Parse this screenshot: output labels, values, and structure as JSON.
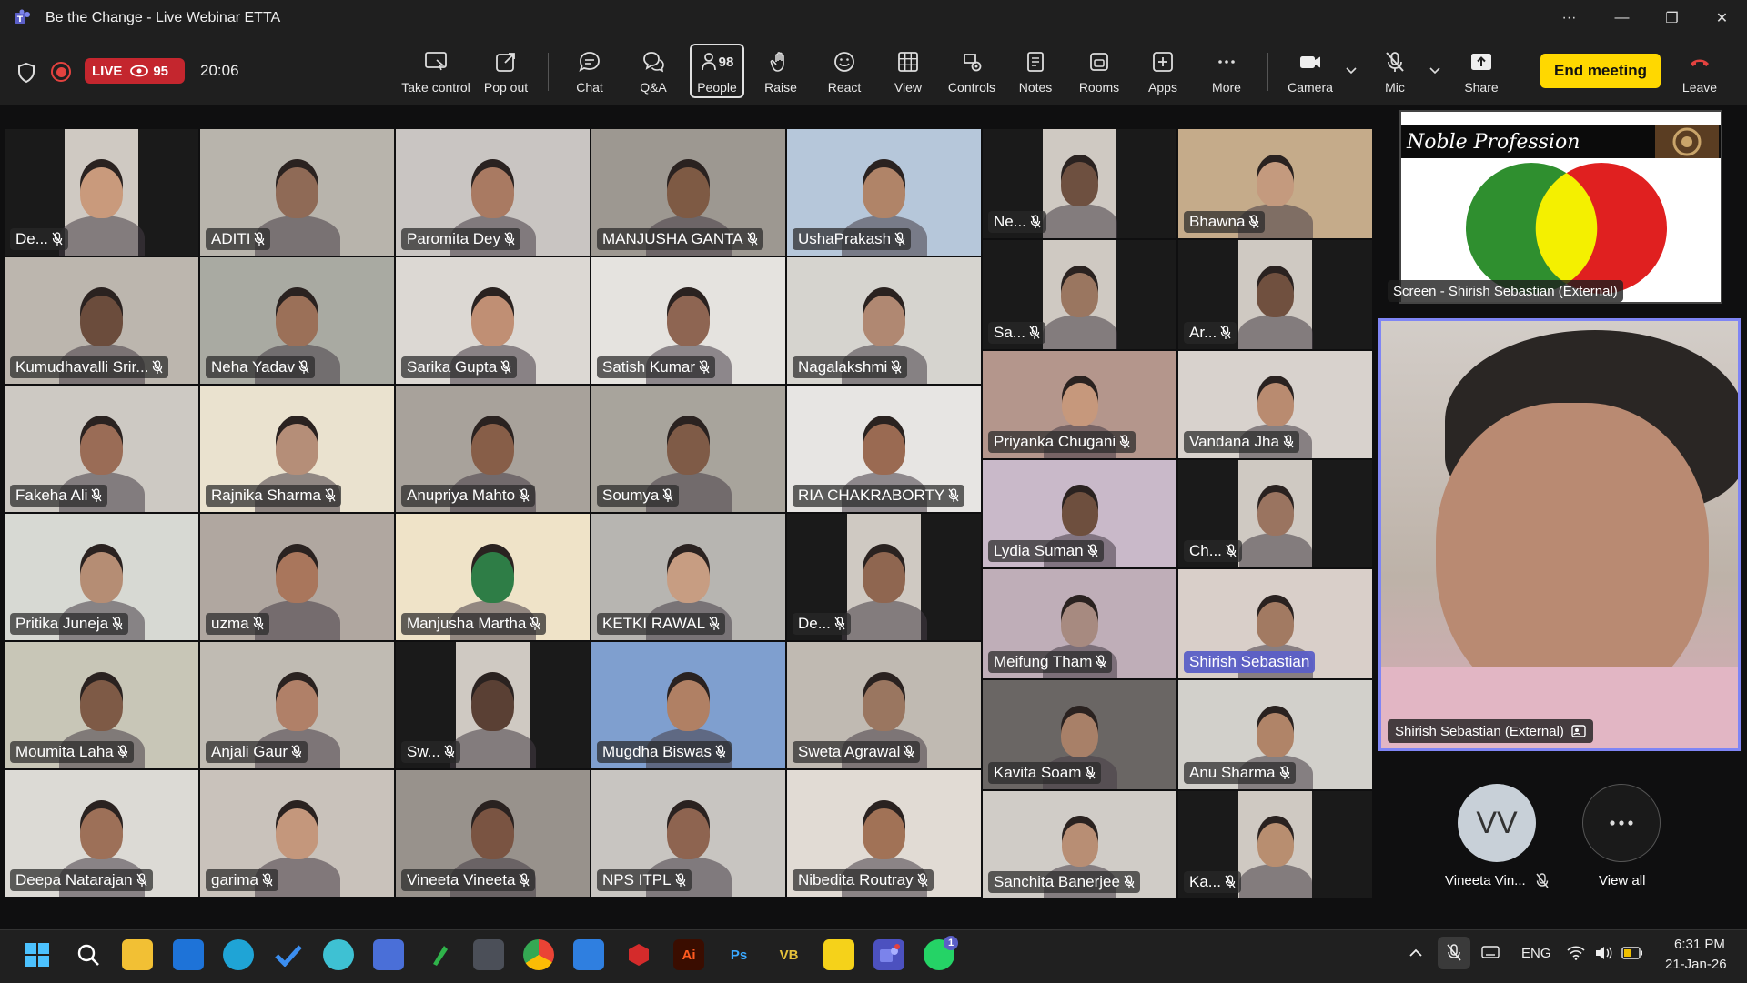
{
  "window": {
    "title": "Be the Change - Live Webinar ETTA",
    "more": "···",
    "minimize": "—",
    "restore": "❐",
    "close": "✕"
  },
  "meeting": {
    "live_label": "LIVE",
    "viewers": "95",
    "timer": "20:06"
  },
  "toolbar": {
    "take_control": "Take control",
    "pop_out": "Pop out",
    "chat": "Chat",
    "qa": "Q&A",
    "people": "People",
    "people_count": "98",
    "raise": "Raise",
    "react": "React",
    "view": "View",
    "controls": "Controls",
    "notes": "Notes",
    "rooms": "Rooms",
    "apps": "Apps",
    "more": "More",
    "camera": "Camera",
    "mic": "Mic",
    "share": "Share",
    "end_meeting": "End meeting",
    "leave": "Leave"
  },
  "participants": [
    {
      "name": "De...",
      "bg": "#1a1a1a",
      "tone": "#c99a7c"
    },
    {
      "name": "ADITI",
      "bg": "#b8b4ac",
      "tone": "#8f6a56"
    },
    {
      "name": "Paromita Dey",
      "bg": "#c9c5c2",
      "tone": "#a97a62"
    },
    {
      "name": "MANJUSHA GANTA",
      "bg": "#9d9891",
      "tone": "#7e5a44"
    },
    {
      "name": "UshaPrakash",
      "bg": "#b6c7da",
      "tone": "#b08468"
    },
    {
      "name": "Ne...",
      "bg": "#1a1a1a",
      "tone": "#6e5040"
    },
    {
      "name": "Bhawna",
      "bg": "#c5ab8a",
      "tone": "#c49a7e"
    },
    {
      "name": "Sa...",
      "bg": "#1a1a1a",
      "tone": "#9a7660"
    },
    {
      "name": "Ar...",
      "bg": "#1a1a1a",
      "tone": "#70503f"
    },
    {
      "name": "Kumudhavalli Srir...",
      "bg": "#bcb6ae",
      "tone": "#6b4c3c"
    },
    {
      "name": "Neha Yadav",
      "bg": "#a9aaa2",
      "tone": "#9b7058"
    },
    {
      "name": "Sarika Gupta",
      "bg": "#dcd8d3",
      "tone": "#c08f74"
    },
    {
      "name": "Satish Kumar",
      "bg": "#e5e3df",
      "tone": "#8e6552"
    },
    {
      "name": "Nagalakshmi",
      "bg": "#d6d4cf",
      "tone": "#b08872"
    },
    {
      "name": "Priyanka Chugani",
      "bg": "#b4968c",
      "tone": "#c6987c"
    },
    {
      "name": "Vandana Jha",
      "bg": "#d8d2cd",
      "tone": "#b98b70"
    },
    {
      "name": "Fakeha Ali",
      "bg": "#cdc9c3",
      "tone": "#9a6c56"
    },
    {
      "name": "Rajnika Sharma",
      "bg": "#eae2cf",
      "tone": "#b58e78"
    },
    {
      "name": "Anupriya Mahto",
      "bg": "#a8a29b",
      "tone": "#875e48"
    },
    {
      "name": "Soumya",
      "bg": "#a8a49c",
      "tone": "#7f5b47"
    },
    {
      "name": "RIA CHAKRABORTY",
      "bg": "#e7e5e3",
      "tone": "#9a6a52"
    },
    {
      "name": "Lydia Suman",
      "bg": "#c9b9c9",
      "tone": "#6e4f3e"
    },
    {
      "name": "Ch...",
      "bg": "#1a1a1a",
      "tone": "#9a7460"
    },
    {
      "name": "Pritika Juneja",
      "bg": "#d7d9d3",
      "tone": "#b58d74"
    },
    {
      "name": "uzma",
      "bg": "#b0a7a0",
      "tone": "#a9765c"
    },
    {
      "name": "Manjusha Martha",
      "bg": "#efe3c8",
      "tone": "#2e7d46"
    },
    {
      "name": "KETKI RAWAL",
      "bg": "#b7b5b1",
      "tone": "#c79d82"
    },
    {
      "name": "De...",
      "bg": "#1a1a1a",
      "tone": "#8f6650"
    },
    {
      "name": "Meifung Tham",
      "bg": "#bfaeb8",
      "tone": "#a78a80"
    },
    {
      "name": "Shirish Sebastian",
      "bg": "#d9cfc9",
      "tone": "#a27a62"
    },
    {
      "name": "Moumita Laha",
      "bg": "#c8c6b7",
      "tone": "#7e5a46"
    },
    {
      "name": "Anjali Gaur",
      "bg": "#c0bbb3",
      "tone": "#b08068"
    },
    {
      "name": "Sw...",
      "bg": "#1a1a1a",
      "tone": "#5a4034"
    },
    {
      "name": "Mugdha Biswas",
      "bg": "#7f9fcf",
      "tone": "#b08064"
    },
    {
      "name": "Sweta Agrawal",
      "bg": "#c0bab2",
      "tone": "#9a7660"
    },
    {
      "name": "Kavita Soam",
      "bg": "#6a6664",
      "tone": "#a88068"
    },
    {
      "name": "Anu Sharma",
      "bg": "#d2d0cb",
      "tone": "#b08468"
    },
    {
      "name": "Deepa Natarajan",
      "bg": "#dcdad5",
      "tone": "#9d7058"
    },
    {
      "name": "garima",
      "bg": "#c9c2bb",
      "tone": "#c4977c"
    },
    {
      "name": "Vineeta Vineeta",
      "bg": "#98928c",
      "tone": "#7a5442"
    },
    {
      "name": "NPS ITPL",
      "bg": "#c8c5c1",
      "tone": "#8e6450"
    },
    {
      "name": "Nibedita Routray",
      "bg": "#e1dbd4",
      "tone": "#a17256"
    },
    {
      "name": "Sanchita Banerjee",
      "bg": "#d0ccc7",
      "tone": "#b88e74"
    },
    {
      "name": "Ka...",
      "bg": "#1a1a1a",
      "tone": "#b88e70"
    }
  ],
  "screen_share": {
    "heading": "Noble Profession",
    "label": "Screen - Shirish Sebastian (External)"
  },
  "speaker": {
    "label": "Shirish Sebastian (External)"
  },
  "overflow": {
    "avatar_initials": "VV",
    "avatar_name": "Vineeta Vin...",
    "view_all": "View all"
  },
  "system_tray": {
    "language": "ENG",
    "time": "6:31 PM",
    "date": "21-Jan-26"
  },
  "taskbar_badges": {
    "whatsapp": "1"
  }
}
